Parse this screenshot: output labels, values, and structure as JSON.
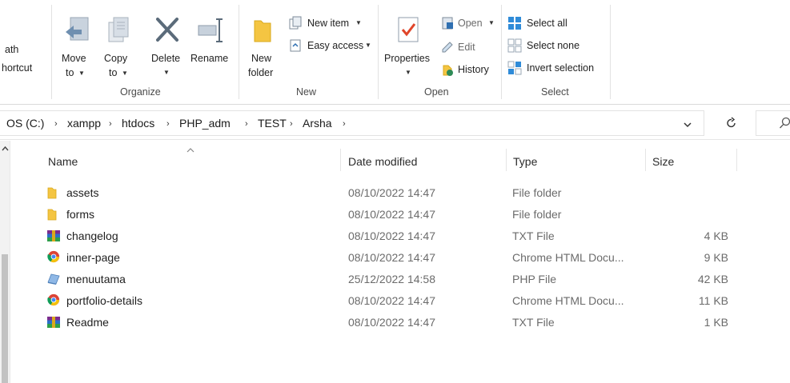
{
  "ribbon": {
    "clipboard": {
      "path_label": "ath",
      "shortcut_label": "hortcut"
    },
    "organize": {
      "group_label": "Organize",
      "move_label": "Move",
      "move_to_label": "to",
      "copy_label": "Copy",
      "copy_to_label": "to",
      "delete_label": "Delete",
      "rename_label": "Rename"
    },
    "new": {
      "group_label": "New",
      "new_folder_label_1": "New",
      "new_folder_label_2": "folder",
      "new_item_label": "New item",
      "easy_access_label": "Easy access"
    },
    "open": {
      "group_label": "Open",
      "properties_label": "Properties",
      "open_label": "Open",
      "edit_label": "Edit",
      "history_label": "History"
    },
    "select": {
      "group_label": "Select",
      "select_all_label": "Select all",
      "select_none_label": "Select none",
      "invert_label": "Invert selection"
    }
  },
  "address": {
    "crumbs": [
      "OS (C:)",
      "xampp",
      "htdocs",
      "PHP_adm",
      "TEST",
      "Arsha"
    ],
    "dropdown_icon": "chevron-down-icon",
    "refresh_icon": "refresh-icon",
    "search_icon": "search-icon"
  },
  "columns": {
    "name": "Name",
    "date": "Date modified",
    "type": "Type",
    "size": "Size"
  },
  "files": [
    {
      "name": "assets",
      "date": "08/10/2022 14:47",
      "type": "File folder",
      "size": "",
      "icon": "folder-icon"
    },
    {
      "name": "forms",
      "date": "08/10/2022 14:47",
      "type": "File folder",
      "size": "",
      "icon": "folder-icon"
    },
    {
      "name": "changelog",
      "date": "08/10/2022 14:47",
      "type": "TXT File",
      "size": "4 KB",
      "icon": "winrar-icon"
    },
    {
      "name": "inner-page",
      "date": "08/10/2022 14:47",
      "type": "Chrome HTML Docu...",
      "size": "9 KB",
      "icon": "chrome-icon"
    },
    {
      "name": "menuutama",
      "date": "25/12/2022 14:58",
      "type": "PHP File",
      "size": "42 KB",
      "icon": "php-file-icon"
    },
    {
      "name": "portfolio-details",
      "date": "08/10/2022 14:47",
      "type": "Chrome HTML Docu...",
      "size": "11 KB",
      "icon": "chrome-icon"
    },
    {
      "name": "Readme",
      "date": "08/10/2022 14:47",
      "type": "TXT File",
      "size": "1 KB",
      "icon": "winrar-icon"
    }
  ],
  "colors": {
    "accent": "#0078d4",
    "folder": "#f4c542",
    "ribbon_border": "#dadada"
  }
}
